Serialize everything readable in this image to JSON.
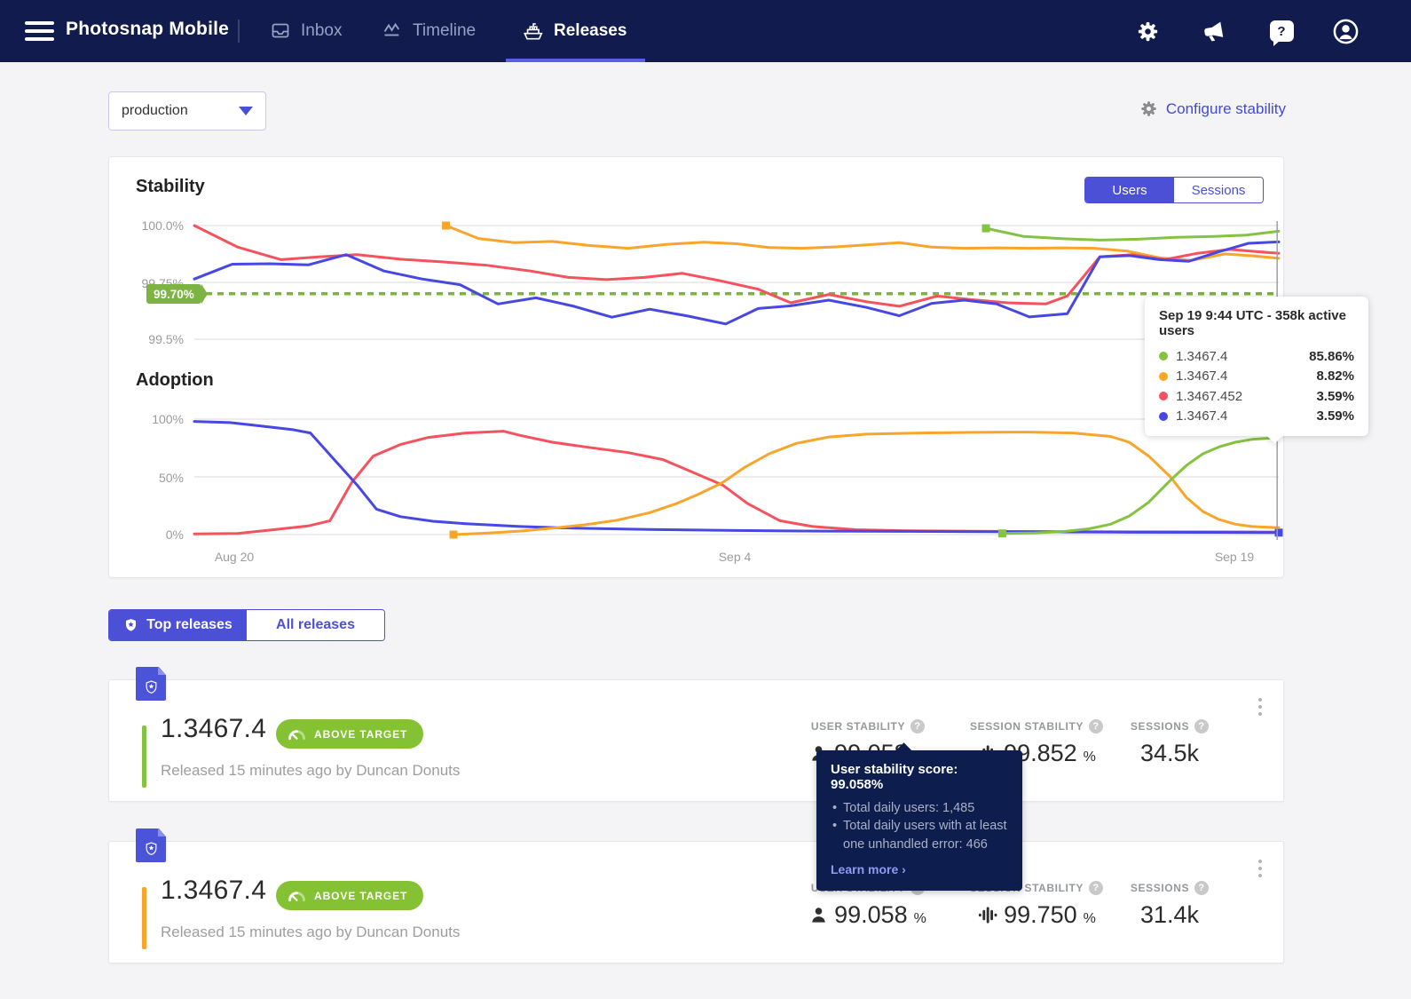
{
  "nav": {
    "app_title": "Photosnap Mobile",
    "items": [
      {
        "label": "Inbox"
      },
      {
        "label": "Timeline"
      },
      {
        "label": "Releases"
      }
    ]
  },
  "toolbar": {
    "stage_filter": "production",
    "configure_label": "Configure stability"
  },
  "stability_section": {
    "title": "Stability",
    "adoption_title": "Adoption",
    "toggle": {
      "users": "Users",
      "sessions": "Sessions"
    }
  },
  "chart_tooltip": {
    "title": "Sep 19 9:44 UTC - 358k active users",
    "rows": [
      {
        "color": "#84c340",
        "version": "1.3467.4",
        "value": "85.86%"
      },
      {
        "color": "#f9a825",
        "version": "1.3467.4",
        "value": "8.82%"
      },
      {
        "color": "#f5525e",
        "version": "1.3467.452",
        "value": "3.59%"
      },
      {
        "color": "#4747e2",
        "version": "1.3467.4",
        "value": "3.59%"
      }
    ]
  },
  "release_tabs": {
    "top": "Top releases",
    "all": "All releases"
  },
  "releases": [
    {
      "version": "1.3467.4",
      "badge": "ABOVE TARGET",
      "released": "Released 15 minutes ago by Duncan Donuts",
      "accent": "#84c340",
      "user_stability_label": "USER STABILITY",
      "user_stability": "99.058",
      "session_stability_label": "SESSION STABILITY",
      "session_stability": "99.852",
      "sessions_label": "SESSIONS",
      "sessions": "34.5k"
    },
    {
      "version": "1.3467.4",
      "badge": "ABOVE TARGET",
      "released": "Released 15 minutes ago by Duncan Donuts",
      "accent": "#f9a42a",
      "user_stability_label": "USER STABILITY",
      "user_stability": "99.058",
      "session_stability_label": "SESSION STABILITY",
      "session_stability": "99.750",
      "sessions_label": "SESSIONS",
      "sessions": "31.4k"
    }
  ],
  "stability_tooltip": {
    "title": "User stability score: 99.058%",
    "bullets": [
      "Total daily users: 1,485",
      "Total daily users with at least one unhandled error: 466"
    ],
    "link": "Learn more ›"
  },
  "glyphs": {
    "percent": "%",
    "question": "?"
  },
  "chart_data": [
    {
      "id": "stability",
      "type": "line",
      "title": "Stability",
      "ylim": [
        99.5,
        100.0
      ],
      "y_ticks": [
        {
          "value": 100.0,
          "label": "100.0%"
        },
        {
          "value": 99.75,
          "label": "99.75%"
        },
        {
          "value": 99.5,
          "label": "99.5%"
        }
      ],
      "target": {
        "value": 99.7,
        "label": "99.70%",
        "color": "#7cb342"
      },
      "hover_x": 0.9985,
      "series": [
        {
          "name": "1.3467.4",
          "color": "#f9a42a",
          "start_marker": true,
          "points": [
            [
              0.232,
              100
            ],
            [
              0.262,
              99.943
            ],
            [
              0.295,
              99.925
            ],
            [
              0.33,
              99.93
            ],
            [
              0.365,
              99.912
            ],
            [
              0.4,
              99.9
            ],
            [
              0.435,
              99.917
            ],
            [
              0.47,
              99.927
            ],
            [
              0.5,
              99.92
            ],
            [
              0.53,
              99.903
            ],
            [
              0.56,
              99.9
            ],
            [
              0.59,
              99.906
            ],
            [
              0.62,
              99.915
            ],
            [
              0.65,
              99.925
            ],
            [
              0.68,
              99.905
            ],
            [
              0.71,
              99.9
            ],
            [
              0.74,
              99.902
            ],
            [
              0.77,
              99.9
            ],
            [
              0.8,
              99.902
            ],
            [
              0.83,
              99.9
            ],
            [
              0.86,
              99.888
            ],
            [
              0.89,
              99.858
            ],
            [
              0.92,
              99.847
            ],
            [
              0.95,
              99.875
            ],
            [
              0.975,
              99.867
            ],
            [
              1,
              99.856
            ]
          ]
        },
        {
          "name": "1.3467.452",
          "color": "#f5525e",
          "points": [
            [
              0,
              100
            ],
            [
              0.04,
              99.905
            ],
            [
              0.08,
              99.85
            ],
            [
              0.115,
              99.862
            ],
            [
              0.15,
              99.872
            ],
            [
              0.19,
              99.852
            ],
            [
              0.23,
              99.84
            ],
            [
              0.27,
              99.825
            ],
            [
              0.31,
              99.8
            ],
            [
              0.345,
              99.772
            ],
            [
              0.38,
              99.762
            ],
            [
              0.415,
              99.772
            ],
            [
              0.45,
              99.79
            ],
            [
              0.485,
              99.757
            ],
            [
              0.52,
              99.72
            ],
            [
              0.55,
              99.66
            ],
            [
              0.585,
              99.697
            ],
            [
              0.62,
              99.665
            ],
            [
              0.65,
              99.645
            ],
            [
              0.685,
              99.69
            ],
            [
              0.715,
              99.675
            ],
            [
              0.75,
              99.66
            ],
            [
              0.785,
              99.655
            ],
            [
              0.805,
              99.69
            ],
            [
              0.835,
              99.863
            ],
            [
              0.865,
              99.872
            ],
            [
              0.895,
              99.85
            ],
            [
              0.925,
              99.878
            ],
            [
              0.955,
              99.895
            ],
            [
              0.98,
              99.885
            ],
            [
              1,
              99.878
            ]
          ]
        },
        {
          "name": "1.3467.4",
          "color": "#4747e2",
          "points": [
            [
              0,
              99.765
            ],
            [
              0.035,
              99.83
            ],
            [
              0.07,
              99.832
            ],
            [
              0.105,
              99.827
            ],
            [
              0.14,
              99.872
            ],
            [
              0.175,
              99.8
            ],
            [
              0.21,
              99.765
            ],
            [
              0.245,
              99.74
            ],
            [
              0.28,
              99.655
            ],
            [
              0.315,
              99.682
            ],
            [
              0.35,
              99.645
            ],
            [
              0.385,
              99.597
            ],
            [
              0.42,
              99.632
            ],
            [
              0.455,
              99.602
            ],
            [
              0.49,
              99.567
            ],
            [
              0.52,
              99.635
            ],
            [
              0.55,
              99.647
            ],
            [
              0.585,
              99.672
            ],
            [
              0.62,
              99.64
            ],
            [
              0.65,
              99.603
            ],
            [
              0.68,
              99.658
            ],
            [
              0.71,
              99.672
            ],
            [
              0.74,
              99.655
            ],
            [
              0.77,
              99.598
            ],
            [
              0.805,
              99.612
            ],
            [
              0.835,
              99.862
            ],
            [
              0.862,
              99.868
            ],
            [
              0.89,
              99.85
            ],
            [
              0.917,
              99.843
            ],
            [
              0.945,
              99.885
            ],
            [
              0.972,
              99.922
            ],
            [
              1,
              99.928
            ]
          ]
        },
        {
          "name": "1.3467.4",
          "color": "#84c340",
          "start_marker": true,
          "points": [
            [
              0.73,
              99.988
            ],
            [
              0.765,
              99.952
            ],
            [
              0.8,
              99.942
            ],
            [
              0.835,
              99.936
            ],
            [
              0.87,
              99.94
            ],
            [
              0.905,
              99.948
            ],
            [
              0.94,
              99.952
            ],
            [
              0.97,
              99.958
            ],
            [
              1,
              99.975
            ]
          ]
        }
      ]
    },
    {
      "id": "adoption",
      "type": "line",
      "title": "Adoption",
      "ylim": [
        0,
        100
      ],
      "y_ticks": [
        {
          "value": 100,
          "label": "100%"
        },
        {
          "value": 50,
          "label": "50%"
        },
        {
          "value": 0,
          "label": "0%"
        }
      ],
      "x_ticks": [
        {
          "x": 0.037,
          "label": "Aug 20"
        },
        {
          "x": 0.498,
          "label": "Sep 4"
        },
        {
          "x": 0.959,
          "label": "Sep 19"
        }
      ],
      "hover_x": 0.9985,
      "series": [
        {
          "name": "1.3467.452",
          "color": "#f5525e",
          "points": [
            [
              0,
              0.5
            ],
            [
              0.04,
              1
            ],
            [
              0.075,
              4.5
            ],
            [
              0.105,
              7.5
            ],
            [
              0.125,
              12
            ],
            [
              0.145,
              45
            ],
            [
              0.165,
              68
            ],
            [
              0.19,
              78
            ],
            [
              0.215,
              84
            ],
            [
              0.25,
              88
            ],
            [
              0.285,
              89.5
            ],
            [
              0.3,
              86
            ],
            [
              0.33,
              80
            ],
            [
              0.36,
              76
            ],
            [
              0.4,
              71
            ],
            [
              0.432,
              65
            ],
            [
              0.457,
              55
            ],
            [
              0.487,
              43
            ],
            [
              0.51,
              27
            ],
            [
              0.54,
              12
            ],
            [
              0.57,
              7
            ],
            [
              0.61,
              4.2
            ],
            [
              0.66,
              3.2
            ],
            [
              0.75,
              2.7
            ],
            [
              0.87,
              2.4
            ],
            [
              1,
              2.2
            ]
          ]
        },
        {
          "name": "1.3467.4",
          "color": "#4747e2",
          "end_marker": true,
          "points": [
            [
              0,
              98
            ],
            [
              0.033,
              97
            ],
            [
              0.066,
              93.5
            ],
            [
              0.09,
              91
            ],
            [
              0.107,
              88
            ],
            [
              0.128,
              66
            ],
            [
              0.15,
              43
            ],
            [
              0.168,
              22
            ],
            [
              0.19,
              15.5
            ],
            [
              0.22,
              11.5
            ],
            [
              0.25,
              9.5
            ],
            [
              0.3,
              7
            ],
            [
              0.35,
              5.5
            ],
            [
              0.42,
              4.5
            ],
            [
              0.5,
              3.5
            ],
            [
              0.58,
              3
            ],
            [
              0.66,
              2.8
            ],
            [
              0.75,
              2.4
            ],
            [
              0.85,
              2.1
            ],
            [
              0.93,
              1.9
            ],
            [
              1,
              1.7
            ]
          ]
        },
        {
          "name": "1.3467.4",
          "color": "#f9a42a",
          "start_marker": true,
          "points": [
            [
              0.239,
              0
            ],
            [
              0.27,
              1.2
            ],
            [
              0.3,
              3
            ],
            [
              0.33,
              5.5
            ],
            [
              0.36,
              8.5
            ],
            [
              0.39,
              12.5
            ],
            [
              0.42,
              19
            ],
            [
              0.445,
              27
            ],
            [
              0.465,
              35
            ],
            [
              0.487,
              45
            ],
            [
              0.507,
              58
            ],
            [
              0.53,
              70
            ],
            [
              0.555,
              79
            ],
            [
              0.585,
              84.5
            ],
            [
              0.62,
              87
            ],
            [
              0.67,
              88
            ],
            [
              0.72,
              88.5
            ],
            [
              0.77,
              88.8
            ],
            [
              0.81,
              88
            ],
            [
              0.845,
              85
            ],
            [
              0.862,
              80
            ],
            [
              0.88,
              68
            ],
            [
              0.9,
              50
            ],
            [
              0.915,
              32
            ],
            [
              0.93,
              20
            ],
            [
              0.945,
              13
            ],
            [
              0.96,
              9
            ],
            [
              0.975,
              7
            ],
            [
              1,
              6
            ]
          ]
        },
        {
          "name": "1.3467.4",
          "color": "#84c340",
          "start_marker": true,
          "points": [
            [
              0.745,
              1
            ],
            [
              0.775,
              1.5
            ],
            [
              0.8,
              2.5
            ],
            [
              0.825,
              5
            ],
            [
              0.845,
              9
            ],
            [
              0.862,
              16
            ],
            [
              0.88,
              28
            ],
            [
              0.9,
              47
            ],
            [
              0.915,
              60
            ],
            [
              0.93,
              70
            ],
            [
              0.945,
              76
            ],
            [
              0.96,
              80
            ],
            [
              0.975,
              82.5
            ],
            [
              1,
              84
            ]
          ]
        }
      ]
    }
  ]
}
